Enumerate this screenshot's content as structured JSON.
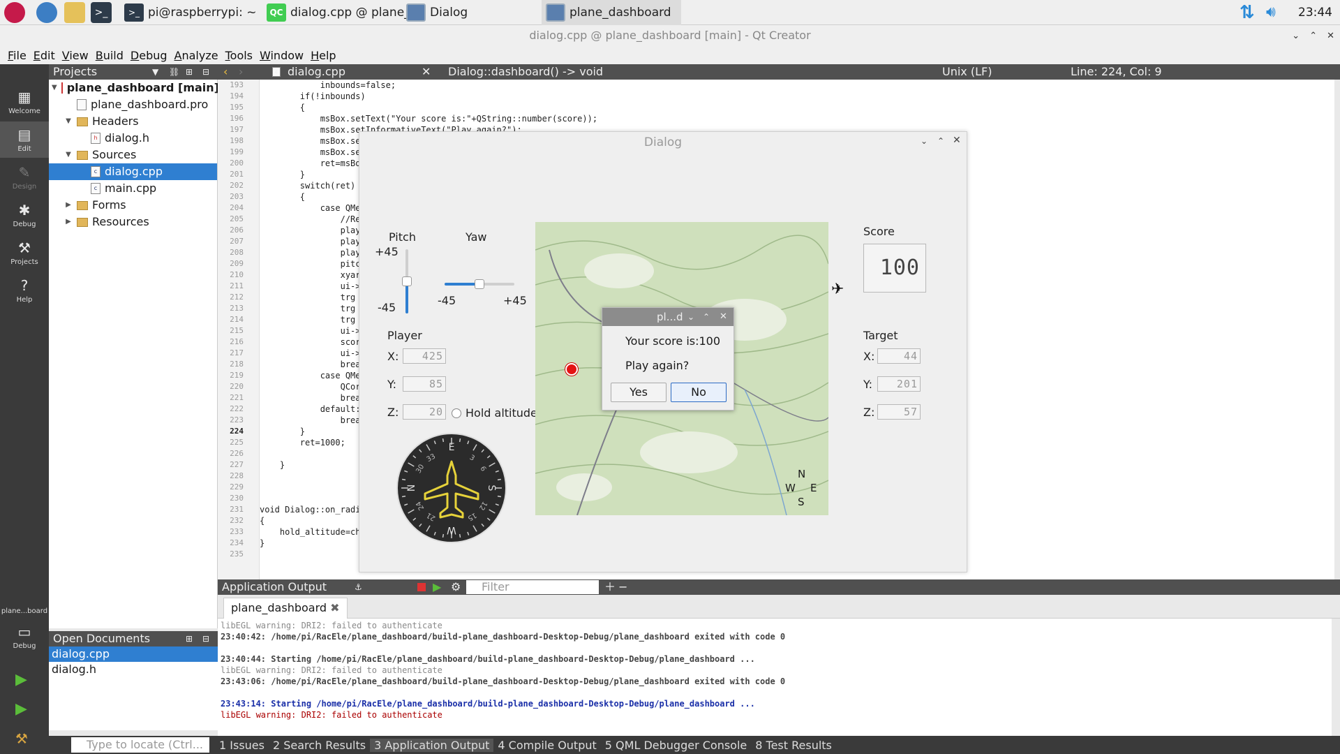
{
  "taskbar": {
    "apps": [
      {
        "label": "pi@raspberrypi: ~"
      },
      {
        "label": "dialog.cpp @ plane_..."
      },
      {
        "label": "Dialog"
      },
      {
        "label": "plane_dashboard"
      }
    ],
    "clock": "23:44"
  },
  "window": {
    "title": "dialog.cpp @ plane_dashboard [main] - Qt Creator",
    "controls": [
      "⌄",
      "⌃",
      "✕"
    ]
  },
  "menu": [
    "File",
    "Edit",
    "View",
    "Build",
    "Debug",
    "Analyze",
    "Tools",
    "Window",
    "Help"
  ],
  "modes": [
    {
      "label": "Welcome",
      "icon": "grid-icon"
    },
    {
      "label": "Edit",
      "icon": "document-icon"
    },
    {
      "label": "Design",
      "icon": "pen-icon"
    },
    {
      "label": "Debug",
      "icon": "bug-icon"
    },
    {
      "label": "Projects",
      "icon": "wrench-icon"
    },
    {
      "label": "Help",
      "icon": "help-icon"
    }
  ],
  "kit": {
    "label": "plane...board",
    "mode": "Debug"
  },
  "projects": {
    "header": "Projects",
    "tree": [
      {
        "label": "plane_dashboard [main]",
        "level": 0,
        "type": "project"
      },
      {
        "label": "plane_dashboard.pro",
        "level": 1,
        "type": "file"
      },
      {
        "label": "Headers",
        "level": 1,
        "type": "folder"
      },
      {
        "label": "dialog.h",
        "level": 2,
        "type": "file"
      },
      {
        "label": "Sources",
        "level": 1,
        "type": "folder"
      },
      {
        "label": "dialog.cpp",
        "level": 2,
        "type": "file",
        "selected": true
      },
      {
        "label": "main.cpp",
        "level": 2,
        "type": "file"
      },
      {
        "label": "Forms",
        "level": 1,
        "type": "folder"
      },
      {
        "label": "Resources",
        "level": 1,
        "type": "folder"
      }
    ]
  },
  "open_documents": {
    "header": "Open Documents",
    "items": [
      "dialog.cpp",
      "dialog.h"
    ]
  },
  "editor": {
    "file": "dialog.cpp",
    "symbol": "Dialog::dashboard() -> void",
    "line_ending": "Unix (LF)",
    "position": "Line: 224, Col: 9",
    "current_line": 224,
    "lines": [
      {
        "n": 193,
        "text": "            inbounds=false;"
      },
      {
        "n": 194,
        "text": "        if(!inbounds)"
      },
      {
        "n": 195,
        "text": "        {"
      },
      {
        "n": 196,
        "text": "            msBox.setText(\"Your score is:\"+QString::number(score));"
      },
      {
        "n": 197,
        "text": "            msBox.setInformativeText(\"Play again?\");"
      },
      {
        "n": 198,
        "text": "            msBox.se"
      },
      {
        "n": 199,
        "text": "            msBox.se"
      },
      {
        "n": 200,
        "text": "            ret=msBo"
      },
      {
        "n": 201,
        "text": "        }"
      },
      {
        "n": 202,
        "text": "        switch(ret)"
      },
      {
        "n": 203,
        "text": "        {"
      },
      {
        "n": 204,
        "text": "            case QMe"
      },
      {
        "n": 205,
        "text": "                //Re"
      },
      {
        "n": 206,
        "text": "                play"
      },
      {
        "n": 207,
        "text": "                play"
      },
      {
        "n": 208,
        "text": "                play"
      },
      {
        "n": 209,
        "text": "                pitc"
      },
      {
        "n": 210,
        "text": "                xyar"
      },
      {
        "n": 211,
        "text": "                ui->"
      },
      {
        "n": 212,
        "text": "                trg"
      },
      {
        "n": 213,
        "text": "                trg"
      },
      {
        "n": 214,
        "text": "                trg"
      },
      {
        "n": 215,
        "text": "                ui->"
      },
      {
        "n": 216,
        "text": "                scor"
      },
      {
        "n": 217,
        "text": "                ui->"
      },
      {
        "n": 218,
        "text": "                brea"
      },
      {
        "n": 219,
        "text": "            case QMe"
      },
      {
        "n": 220,
        "text": "                QCor"
      },
      {
        "n": 221,
        "text": "                brea"
      },
      {
        "n": 222,
        "text": "            default:"
      },
      {
        "n": 223,
        "text": "                brea"
      },
      {
        "n": 224,
        "text": "        }"
      },
      {
        "n": 225,
        "text": "        ret=1000;"
      },
      {
        "n": 226,
        "text": ""
      },
      {
        "n": 227,
        "text": "    }"
      },
      {
        "n": 228,
        "text": ""
      },
      {
        "n": 229,
        "text": ""
      },
      {
        "n": 230,
        "text": ""
      },
      {
        "n": 231,
        "text": "void Dialog::on_radi"
      },
      {
        "n": 232,
        "text": "{"
      },
      {
        "n": 233,
        "text": "    hold_altitude=ch"
      },
      {
        "n": 234,
        "text": "}"
      },
      {
        "n": 235,
        "text": ""
      }
    ]
  },
  "dialog": {
    "title": "Dialog",
    "pitch": {
      "label": "Pitch",
      "max": "+45",
      "min": "-45",
      "value_fraction": 0.5
    },
    "yaw": {
      "label": "Yaw",
      "min": "-45",
      "max": "+45",
      "value_fraction": 0.5
    },
    "player": {
      "label": "Player",
      "x_label": "X:",
      "x": "425",
      "y_label": "Y:",
      "y": "85",
      "z_label": "Z:",
      "z": "20"
    },
    "hold_altitude": "Hold altitude",
    "score": {
      "label": "Score",
      "value": "100"
    },
    "target": {
      "label": "Target",
      "x_label": "X:",
      "x": "44",
      "y_label": "Y:",
      "y": "201",
      "z_label": "Z:",
      "z": "57"
    },
    "compass_rose": {
      "n": "N",
      "e": "E",
      "s": "S",
      "w": "W"
    },
    "compass_dial": {
      "e": "E",
      "s": "S",
      "w": "W",
      "n": "N",
      "ticks": [
        "3",
        "6",
        "12",
        "15",
        "21",
        "24",
        "30",
        "33"
      ]
    }
  },
  "messagebox": {
    "title": "pl...d",
    "text": "Your score is:100",
    "informative": "Play again?",
    "yes": "Yes",
    "no": "No"
  },
  "output": {
    "header": "Application Output",
    "filter_placeholder": "Filter",
    "tab": "plane_dashboard",
    "lines": [
      {
        "kind": "warn",
        "text": "libEGL warning: DRI2: failed to authenticate"
      },
      {
        "kind": "info",
        "text": "23:40:42: /home/pi/RacEle/plane_dashboard/build-plane_dashboard-Desktop-Debug/plane_dashboard exited with code 0"
      },
      {
        "kind": "blank",
        "text": ""
      },
      {
        "kind": "info",
        "text": "23:40:44: Starting /home/pi/RacEle/plane_dashboard/build-plane_dashboard-Desktop-Debug/plane_dashboard ..."
      },
      {
        "kind": "warn",
        "text": "libEGL warning: DRI2: failed to authenticate"
      },
      {
        "kind": "info",
        "text": "23:43:06: /home/pi/RacEle/plane_dashboard/build-plane_dashboard-Desktop-Debug/plane_dashboard exited with code 0"
      },
      {
        "kind": "blank",
        "text": ""
      },
      {
        "kind": "blue",
        "text": "23:43:14: Starting /home/pi/RacEle/plane_dashboard/build-plane_dashboard-Desktop-Debug/plane_dashboard ..."
      },
      {
        "kind": "warn2",
        "text": "libEGL warning: DRI2: failed to authenticate"
      }
    ]
  },
  "statusbar": {
    "locator_placeholder": "Type to locate (Ctrl...",
    "tabs": [
      "1 Issues",
      "2 Search Results",
      "3 Application Output",
      "4 Compile Output",
      "5 QML Debugger Console",
      "8 Test Results"
    ],
    "active_tab": 2
  },
  "colors": {
    "accent": "#2f7fd1",
    "dark_panel": "#3a3a3a",
    "header": "#505050"
  }
}
